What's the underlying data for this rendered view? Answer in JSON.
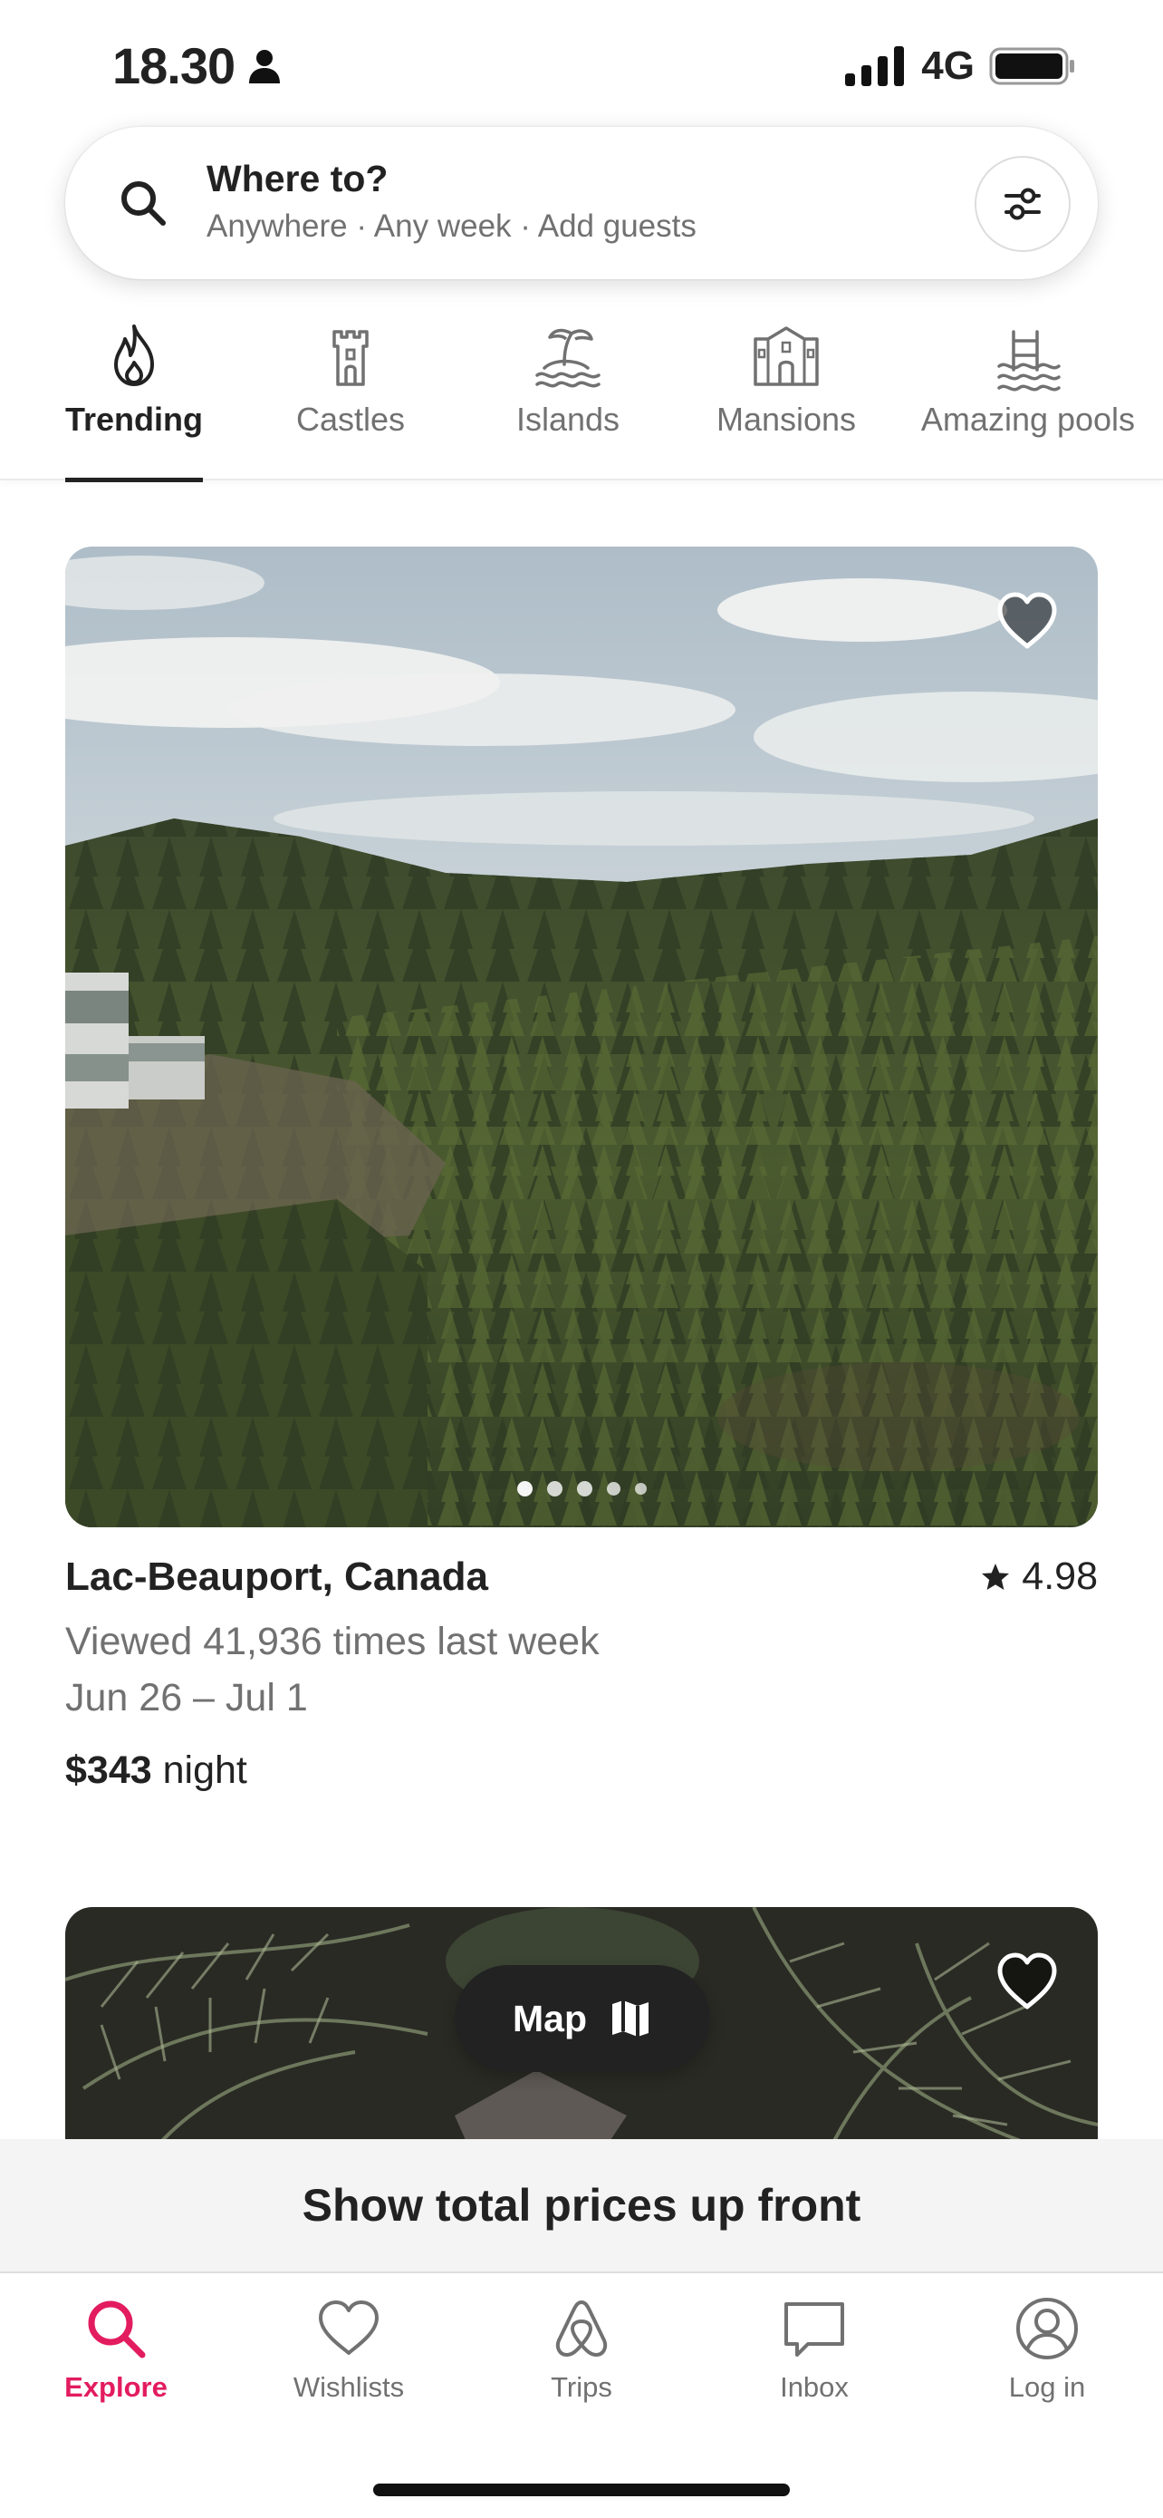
{
  "status_bar": {
    "time": "18.30",
    "network": "4G",
    "icons": [
      "person-icon",
      "signal-icon",
      "battery-icon"
    ]
  },
  "search": {
    "title": "Where to?",
    "subtitle": "Anywhere · Any week · Add guests",
    "icons": [
      "search-icon",
      "filters-icon"
    ]
  },
  "categories": [
    {
      "label": "Trending",
      "icon": "flame-icon",
      "active": true
    },
    {
      "label": "Castles",
      "icon": "castle-icon",
      "active": false
    },
    {
      "label": "Islands",
      "icon": "island-icon",
      "active": false
    },
    {
      "label": "Mansions",
      "icon": "mansion-icon",
      "active": false
    },
    {
      "label": "Amazing pools",
      "icon": "pool-icon",
      "active": false
    }
  ],
  "listings": [
    {
      "location": "Lac-Beauport, Canada",
      "rating": "4.98",
      "views": "Viewed 41,936 times last week",
      "dates": "Jun 26 – Jul 1",
      "price": "$343",
      "price_unit": "night",
      "photo_count_dots": 5,
      "active_photo_index": 0
    }
  ],
  "map_button": {
    "label": "Map"
  },
  "banner": {
    "text": "Show total prices up front"
  },
  "bottom_nav": [
    {
      "label": "Explore",
      "icon": "search-icon",
      "active": true
    },
    {
      "label": "Wishlists",
      "icon": "heart-icon",
      "active": false
    },
    {
      "label": "Trips",
      "icon": "airbnb-logo-icon",
      "active": false
    },
    {
      "label": "Inbox",
      "icon": "message-icon",
      "active": false
    },
    {
      "label": "Log in",
      "icon": "user-circle-icon",
      "active": false
    }
  ],
  "colors": {
    "accent": "#e31c5f",
    "text": "#222222",
    "muted": "#717171",
    "banner_bg": "#f4f4f4"
  }
}
